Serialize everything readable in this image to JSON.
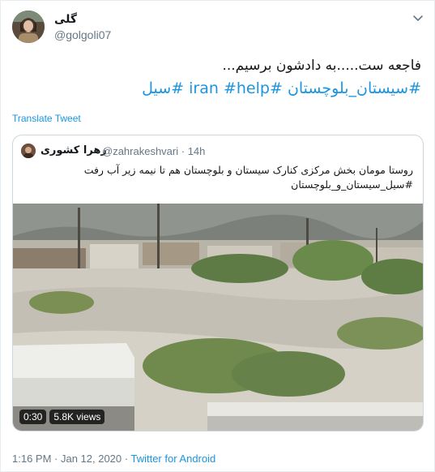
{
  "author": {
    "display_name": "گلی",
    "handle": "@golgoli07"
  },
  "tweet": {
    "line1": "فاجعه ست.....به دادشون برسیم...",
    "hashtags": [
      "#سیل",
      "#help",
      "#iran",
      "#سیستان_بلوچستان"
    ]
  },
  "translate_label": "Translate Tweet",
  "quoted": {
    "display_name": "زهرا کشوری",
    "handle": "@zahrakeshvari",
    "time": "14h",
    "text_line1": "روستا مومان بخش مرکزی کنارک سیستان و بلوچستان هم تا نیمه زیر آب رفت",
    "text_line2": "#سیل_سیستان_و_بلوچستان",
    "video": {
      "duration": "0:30",
      "views": "5.8K views"
    }
  },
  "footer": {
    "timestamp": "1:16 PM · Jan 12, 2020 · ",
    "source": "Twitter for Android"
  },
  "colors": {
    "link": "#1b95e0",
    "muted": "#657786",
    "border": "#e6ecf0"
  },
  "icons": {
    "chevron": "chevron-down-icon"
  }
}
